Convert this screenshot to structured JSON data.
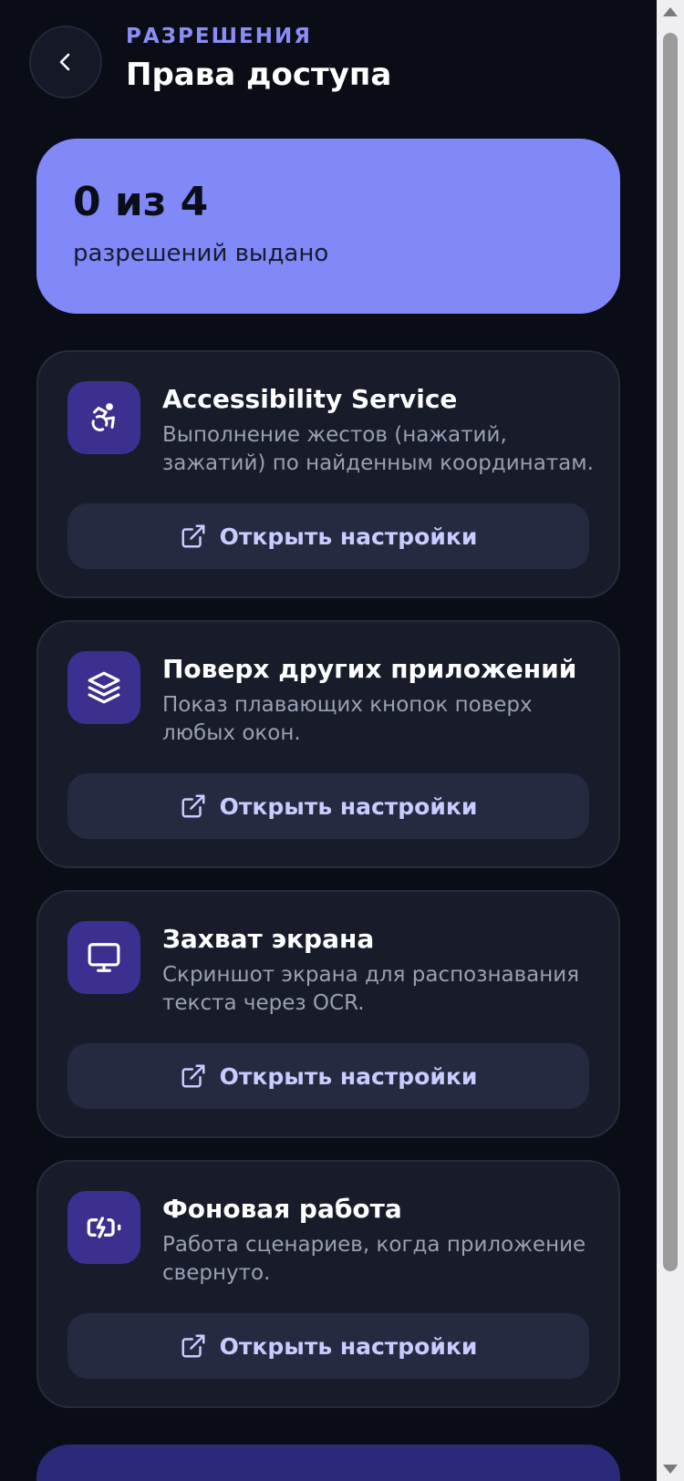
{
  "header": {
    "eyebrow": "РАЗРЕШЕНИЯ",
    "title": "Права доступа",
    "back_icon": "chevron-left-icon"
  },
  "summary": {
    "count": "0 из 4",
    "subtitle": "разрешений выдано",
    "granted": 0,
    "total": 4
  },
  "permissions": [
    {
      "icon": "accessibility-icon",
      "title": "Accessibility Service",
      "description": "Выполнение жестов (нажатий, зажатий) по найденным координатам.",
      "button_label": "Открыть настройки"
    },
    {
      "icon": "layers-icon",
      "title": "Поверх других приложений",
      "description": "Показ плавающих кнопок поверх любых окон.",
      "button_label": "Открыть настройки"
    },
    {
      "icon": "monitor-icon",
      "title": "Захват экрана",
      "description": "Скриншот экрана для распознавания текста через OCR.",
      "button_label": "Открыть настройки"
    },
    {
      "icon": "battery-charging-icon",
      "title": "Фоновая работа",
      "description": "Работа сценариев, когда приложение свернуто.",
      "button_label": "Открыть настройки"
    }
  ],
  "colors": {
    "background": "#0a0d16",
    "accent": "#8189f8",
    "card": "#171b2a",
    "icon_bg": "#3b2f8f",
    "button_text": "#c9ccff"
  }
}
